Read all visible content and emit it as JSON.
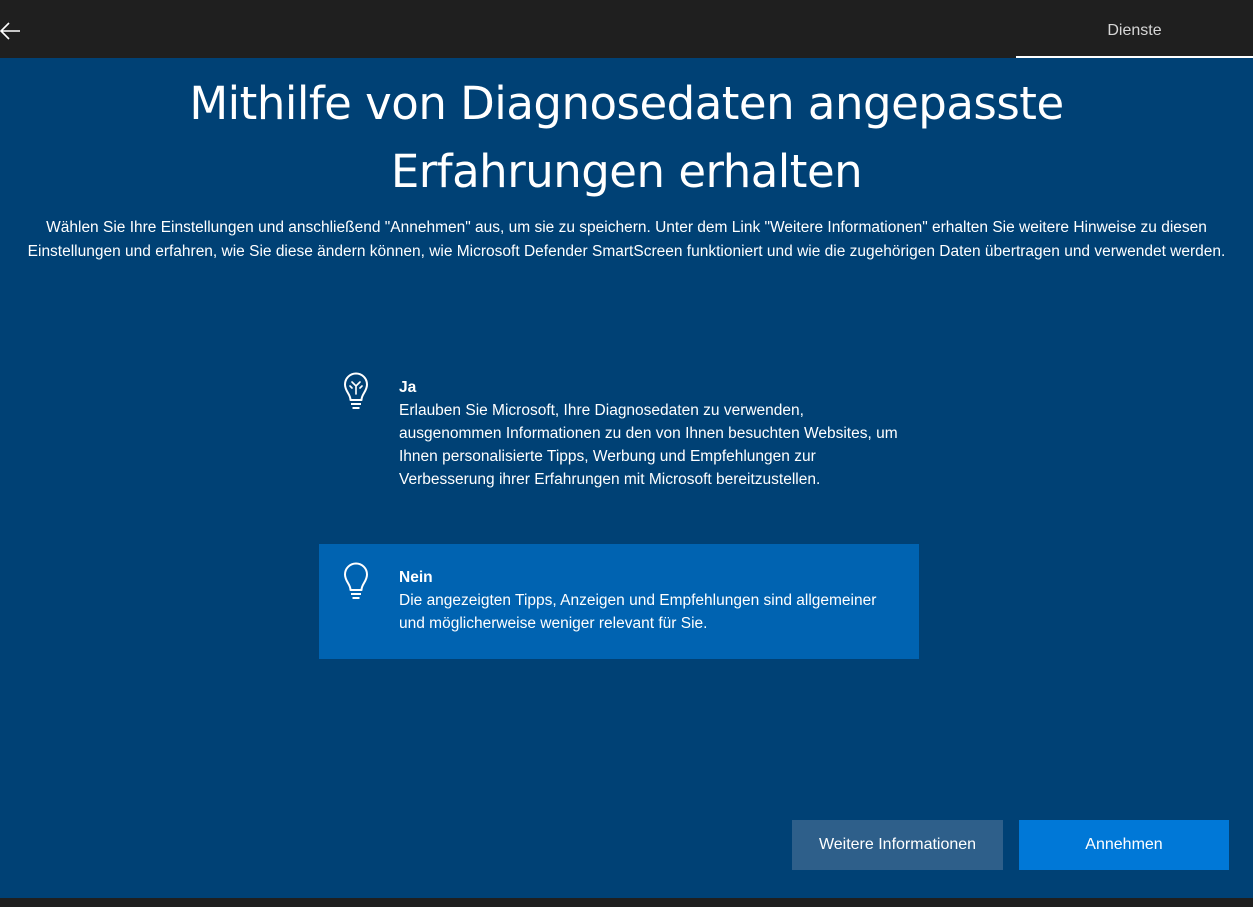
{
  "header": {
    "back_icon": "arrow-left-icon",
    "tab_label": "Dienste"
  },
  "main": {
    "title_line1": "Mithilfe von Diagnosedaten angepasste",
    "title_line2": "Erfahrungen erhalten",
    "description": "Wählen Sie Ihre Einstellungen und anschließend \"Annehmen\" aus, um sie zu speichern. Unter dem Link \"Weitere Informationen\" erhalten Sie weitere Hinweise zu diesen Einstellungen und erfahren, wie Sie diese ändern können, wie Microsoft Defender SmartScreen funktioniert und wie die zugehörigen Daten übertragen und verwendet werden."
  },
  "options": [
    {
      "title": "Ja",
      "description": "Erlauben Sie Microsoft, Ihre Diagnosedaten zu verwenden, ausgenommen Informationen zu den von Ihnen besuchten Websites, um Ihnen personalisierte Tipps, Werbung und Empfehlungen zur Verbesserung ihrer Erfahrungen mit Microsoft bereitzustellen.",
      "icon": "lightbulb-on-icon",
      "selected": false
    },
    {
      "title": "Nein",
      "description": "Die angezeigten Tipps, Anzeigen und Empfehlungen sind allgemeiner und möglicherweise weniger relevant für Sie.",
      "icon": "lightbulb-off-icon",
      "selected": true
    }
  ],
  "buttons": {
    "more_info": "Weitere Informationen",
    "accept": "Annehmen"
  },
  "colors": {
    "background": "#004175",
    "topbar": "#1f1f1f",
    "selected_option": "#0063b1",
    "primary_button": "#0078d7",
    "secondary_button": "#2e5f8a"
  }
}
